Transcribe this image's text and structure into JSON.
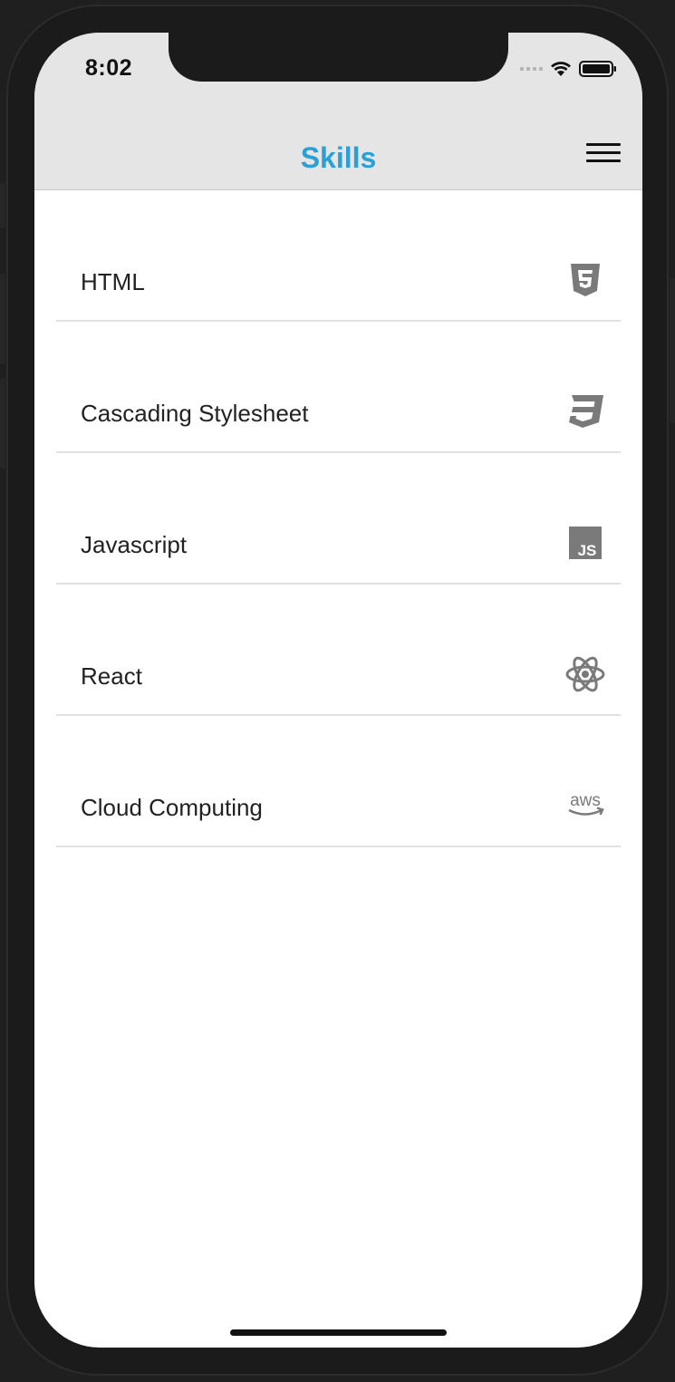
{
  "status_bar": {
    "time": "8:02"
  },
  "header": {
    "title": "Skills",
    "title_color": "#2a9fd8",
    "menu_icon": "hamburger-menu-icon"
  },
  "skills": [
    {
      "label": "HTML",
      "icon": "html5-icon"
    },
    {
      "label": "Cascading Stylesheet",
      "icon": "css3-icon"
    },
    {
      "label": "Javascript",
      "icon": "javascript-icon"
    },
    {
      "label": "React",
      "icon": "react-icon"
    },
    {
      "label": "Cloud Computing",
      "icon": "aws-icon"
    }
  ],
  "icon_color": "#7a7a7a",
  "aws_text": "aws"
}
